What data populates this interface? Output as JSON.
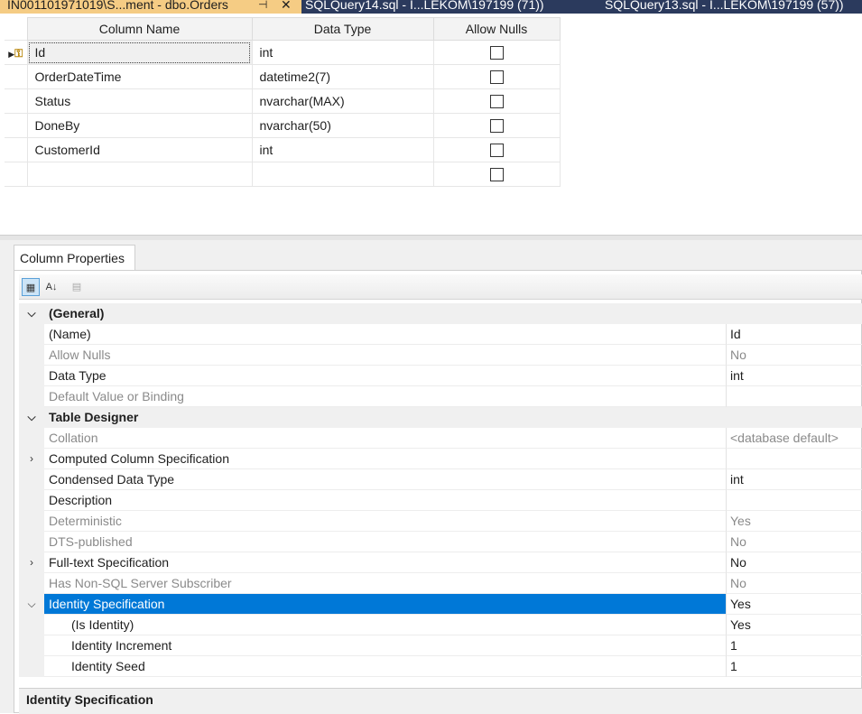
{
  "tabs": [
    {
      "label": "IN001101971019\\S...ment - dbo.Orders",
      "active": true
    },
    {
      "label": "SQLQuery14.sql - I...LEKOM\\197199 (71))"
    },
    {
      "label": "SQLQuery13.sql - I...LEKOM\\197199 (57))"
    }
  ],
  "grid": {
    "headers": {
      "name": "Column Name",
      "type": "Data Type",
      "nulls": "Allow Nulls"
    },
    "rows": [
      {
        "name": "Id",
        "type": "int"
      },
      {
        "name": "OrderDateTime",
        "type": "datetime2(7)"
      },
      {
        "name": "Status",
        "type": "nvarchar(MAX)"
      },
      {
        "name": "DoneBy",
        "type": "nvarchar(50)"
      },
      {
        "name": "CustomerId",
        "type": "int"
      },
      {
        "name": "",
        "type": ""
      }
    ]
  },
  "props": {
    "tab_label": "Column Properties",
    "rows": [
      {
        "name": "(General)",
        "value": ""
      },
      {
        "name": "(Name)",
        "value": "Id"
      },
      {
        "name": "Allow Nulls",
        "value": "No"
      },
      {
        "name": "Data Type",
        "value": "int"
      },
      {
        "name": "Default Value or Binding",
        "value": ""
      },
      {
        "name": "Table Designer",
        "value": ""
      },
      {
        "name": "Collation",
        "value": "<database default>"
      },
      {
        "name": "Computed Column Specification",
        "value": ""
      },
      {
        "name": "Condensed Data Type",
        "value": "int"
      },
      {
        "name": "Description",
        "value": ""
      },
      {
        "name": "Deterministic",
        "value": "Yes"
      },
      {
        "name": "DTS-published",
        "value": "No"
      },
      {
        "name": "Full-text Specification",
        "value": "No"
      },
      {
        "name": "Has Non-SQL Server Subscriber",
        "value": "No"
      },
      {
        "name": "Identity Specification",
        "value": "Yes"
      },
      {
        "name": "(Is Identity)",
        "value": "Yes"
      },
      {
        "name": "Identity Increment",
        "value": "1"
      },
      {
        "name": "Identity Seed",
        "value": "1"
      }
    ],
    "description": "Identity Specification"
  }
}
